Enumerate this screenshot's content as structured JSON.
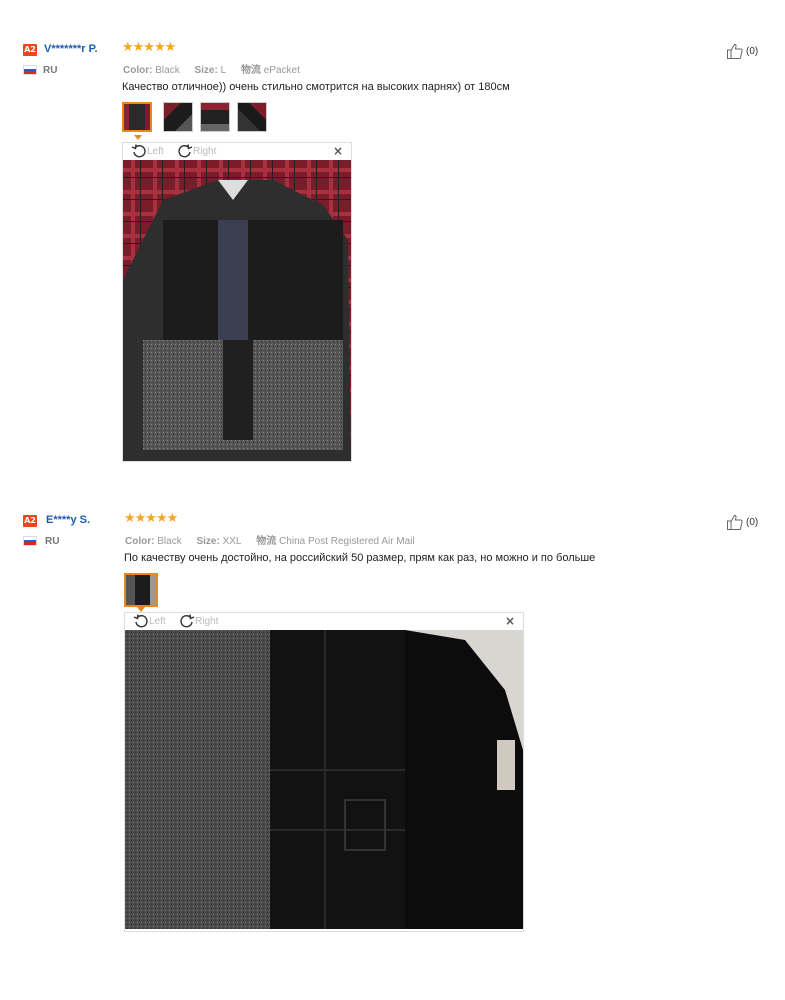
{
  "reviews": [
    {
      "badge": "A2",
      "username": "V*******r P.",
      "country": "RU",
      "stars": "★★★★★",
      "color_label": "Color:",
      "color_value": "Black",
      "size_label": "Size:",
      "size_value": "L",
      "ship_label": "物流",
      "ship_value": "ePacket",
      "text": "Качество отличное)) очень стильно смотрится на высоких парнях) от 180см",
      "like_count": "(0)",
      "rotate_left": "Left",
      "rotate_right": "Right",
      "close": "×"
    },
    {
      "badge": "A2",
      "username": "E****y S.",
      "country": "RU",
      "stars": "★★★★★",
      "color_label": "Color:",
      "color_value": "Black",
      "size_label": "Size:",
      "size_value": "XXL",
      "ship_label": "物流",
      "ship_value": "China Post Registered Air Mail",
      "text": "По качеству очень достойно, на российский 50 размер, прям как раз, но можно и по больше",
      "like_count": "(0)",
      "rotate_left": "Left",
      "rotate_right": "Right",
      "close": "×"
    }
  ],
  "colors": {
    "star": "#f5a623",
    "username": "#1a5db4",
    "badge": "#e64a19",
    "selected_thumb": "#e8891d"
  }
}
